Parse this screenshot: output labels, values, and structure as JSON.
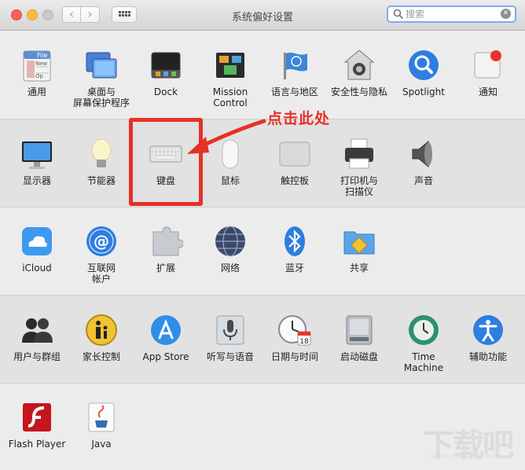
{
  "window": {
    "title": "系统偏好设置",
    "search": {
      "placeholder": "搜索",
      "value": ""
    }
  },
  "rows": [
    {
      "items": [
        {
          "id": "general",
          "label": "通用",
          "icon": "general-icon"
        },
        {
          "id": "desktop",
          "label": "桌面与\n屏幕保护程序",
          "icon": "desktop-screensaver-icon"
        },
        {
          "id": "dock",
          "label": "Dock",
          "icon": "dock-icon"
        },
        {
          "id": "mission",
          "label": "Mission\nControl",
          "icon": "mission-control-icon"
        },
        {
          "id": "language",
          "label": "语言与地区",
          "icon": "language-region-icon"
        },
        {
          "id": "security",
          "label": "安全性与隐私",
          "icon": "security-privacy-icon"
        },
        {
          "id": "spotlight",
          "label": "Spotlight",
          "icon": "spotlight-icon"
        },
        {
          "id": "notifications",
          "label": "通知",
          "icon": "notifications-icon"
        }
      ]
    },
    {
      "items": [
        {
          "id": "displays",
          "label": "显示器",
          "icon": "displays-icon"
        },
        {
          "id": "energy",
          "label": "节能器",
          "icon": "energy-saver-icon"
        },
        {
          "id": "keyboard",
          "label": "键盘",
          "icon": "keyboard-icon"
        },
        {
          "id": "mouse",
          "label": "鼠标",
          "icon": "mouse-icon"
        },
        {
          "id": "trackpad",
          "label": "触控板",
          "icon": "trackpad-icon"
        },
        {
          "id": "printers",
          "label": "打印机与\n扫描仪",
          "icon": "printer-scanner-icon"
        },
        {
          "id": "sound",
          "label": "声音",
          "icon": "sound-icon"
        }
      ]
    },
    {
      "items": [
        {
          "id": "icloud",
          "label": "iCloud",
          "icon": "icloud-icon"
        },
        {
          "id": "internet",
          "label": "互联网\n帐户",
          "icon": "internet-accounts-icon"
        },
        {
          "id": "extensions",
          "label": "扩展",
          "icon": "extensions-icon"
        },
        {
          "id": "network",
          "label": "网络",
          "icon": "network-icon"
        },
        {
          "id": "bluetooth",
          "label": "蓝牙",
          "icon": "bluetooth-icon"
        },
        {
          "id": "sharing",
          "label": "共享",
          "icon": "sharing-icon"
        }
      ]
    },
    {
      "items": [
        {
          "id": "users",
          "label": "用户与群组",
          "icon": "users-groups-icon"
        },
        {
          "id": "parental",
          "label": "家长控制",
          "icon": "parental-controls-icon"
        },
        {
          "id": "appstore",
          "label": "App Store",
          "icon": "app-store-icon"
        },
        {
          "id": "dictation",
          "label": "听写与语音",
          "icon": "dictation-speech-icon"
        },
        {
          "id": "datetime",
          "label": "日期与时间",
          "icon": "date-time-icon"
        },
        {
          "id": "startup",
          "label": "启动磁盘",
          "icon": "startup-disk-icon"
        },
        {
          "id": "timemachine",
          "label": "Time Machine",
          "icon": "time-machine-icon"
        },
        {
          "id": "accessibility",
          "label": "辅助功能",
          "icon": "accessibility-icon"
        }
      ]
    },
    {
      "items": [
        {
          "id": "flash",
          "label": "Flash Player",
          "icon": "flash-player-icon"
        },
        {
          "id": "java",
          "label": "Java",
          "icon": "java-icon"
        }
      ]
    }
  ],
  "icon_texts": {
    "general_file": "File",
    "general_new": "New",
    "general_open": "Op",
    "calendar_day": "18"
  },
  "annotation": {
    "text": "点击此处",
    "color": "#e53128"
  },
  "watermark": {
    "text": "下载吧",
    "url": "www.xiazaiba.com"
  },
  "colors": {
    "accent": "#2f7de1",
    "annotation": "#e53128",
    "search_focus": "#7eabee"
  }
}
